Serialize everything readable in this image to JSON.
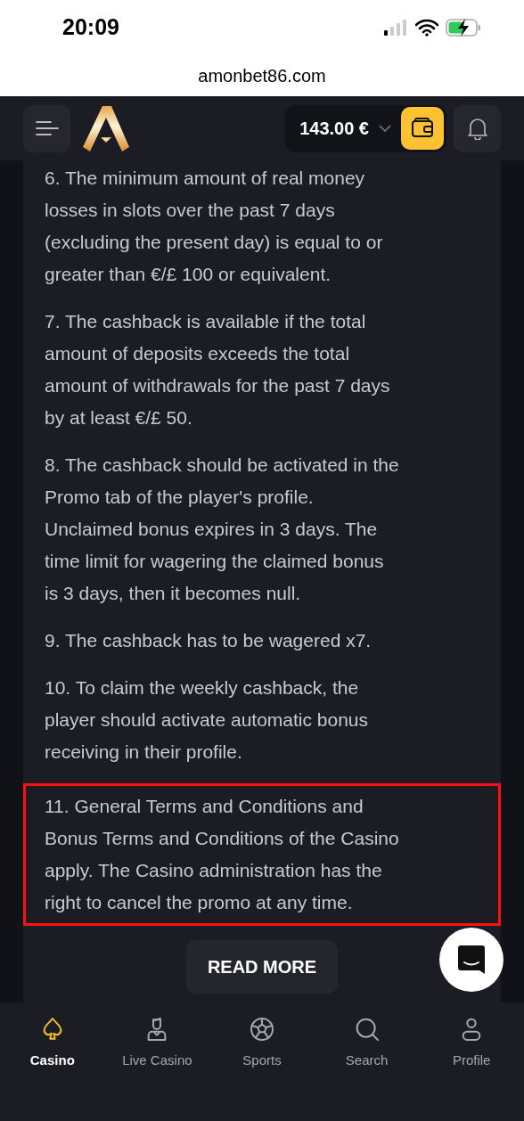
{
  "status_bar": {
    "time": "20:09"
  },
  "address_bar": {
    "url": "amonbet86.com"
  },
  "header": {
    "balance": "143.00 €"
  },
  "terms": [
    {
      "lines": [
        "6. The minimum amount of real money",
        "losses in slots over the past 7 days",
        "(excluding the present day) is equal to or",
        "greater than €/£ 100 or equivalent."
      ],
      "highlighted": false
    },
    {
      "lines": [
        "7. The cashback is available if the total",
        "amount of deposits exceeds the total",
        "amount of withdrawals for the past 7 days",
        "by at least €/£ 50."
      ],
      "highlighted": false
    },
    {
      "lines": [
        "8. The cashback should be activated in the",
        "Promo tab of the player's profile.",
        "Unclaimed bonus expires in 3 days. The",
        "time limit for wagering the claimed bonus",
        "is 3 days, then it becomes null."
      ],
      "highlighted": false
    },
    {
      "lines": [
        "9. The cashback has to be wagered x7."
      ],
      "highlighted": false
    },
    {
      "lines": [
        "10. To claim the weekly cashback, the",
        "player should activate automatic bonus",
        "receiving in their profile."
      ],
      "highlighted": false
    },
    {
      "lines": [
        "11. General Terms and Conditions and",
        "Bonus Terms and Conditions of the Casino",
        "apply. The Casino administration has the",
        "right to cancel the promo at any time."
      ],
      "highlighted": true
    }
  ],
  "read_more": "READ MORE",
  "bottom_nav": [
    {
      "kind": "spade",
      "label": "Casino",
      "selected": true
    },
    {
      "kind": "dealer",
      "label": "Live Casino",
      "selected": false
    },
    {
      "kind": "ball",
      "label": "Sports",
      "selected": false
    },
    {
      "kind": "search",
      "label": "Search",
      "selected": false
    },
    {
      "kind": "person",
      "label": "Profile",
      "selected": false
    }
  ]
}
